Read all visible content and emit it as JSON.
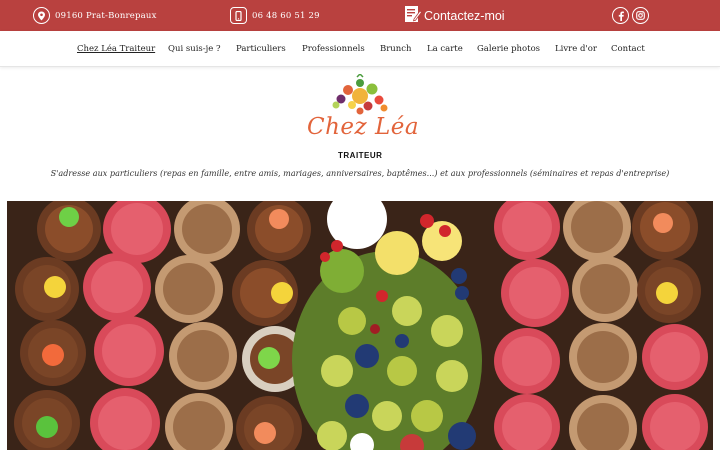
{
  "topbar": {
    "address": "09160 Prat-Bonrepaux",
    "phone": "06 48 60 51 29",
    "contact_label": "Contactez-moi",
    "icons": [
      "map-pin-icon",
      "phone-icon",
      "contact-form-icon",
      "facebook-icon",
      "instagram-icon"
    ]
  },
  "nav": {
    "items": [
      {
        "label": "Chez Léa Traiteur",
        "active": true
      },
      {
        "label": "Qui suis-je ?"
      },
      {
        "label": "Particuliers"
      },
      {
        "label": "Professionnels"
      },
      {
        "label": "Brunch"
      },
      {
        "label": "La carte"
      },
      {
        "label": "Galerie photos"
      },
      {
        "label": "Livre d'or"
      },
      {
        "label": "Contact"
      }
    ]
  },
  "logo": {
    "script": "Chez Léa",
    "subtitle": "TRAITEUR"
  },
  "tagline": "S'adresse aux particuliers (repas en famille, entre amis, mariages, anniversaires, baptêmes...) et aux professionnels (séminaires et repas d'entreprise)",
  "colors": {
    "topbar": "#b9413f",
    "logo_orange": "#e2643b"
  }
}
